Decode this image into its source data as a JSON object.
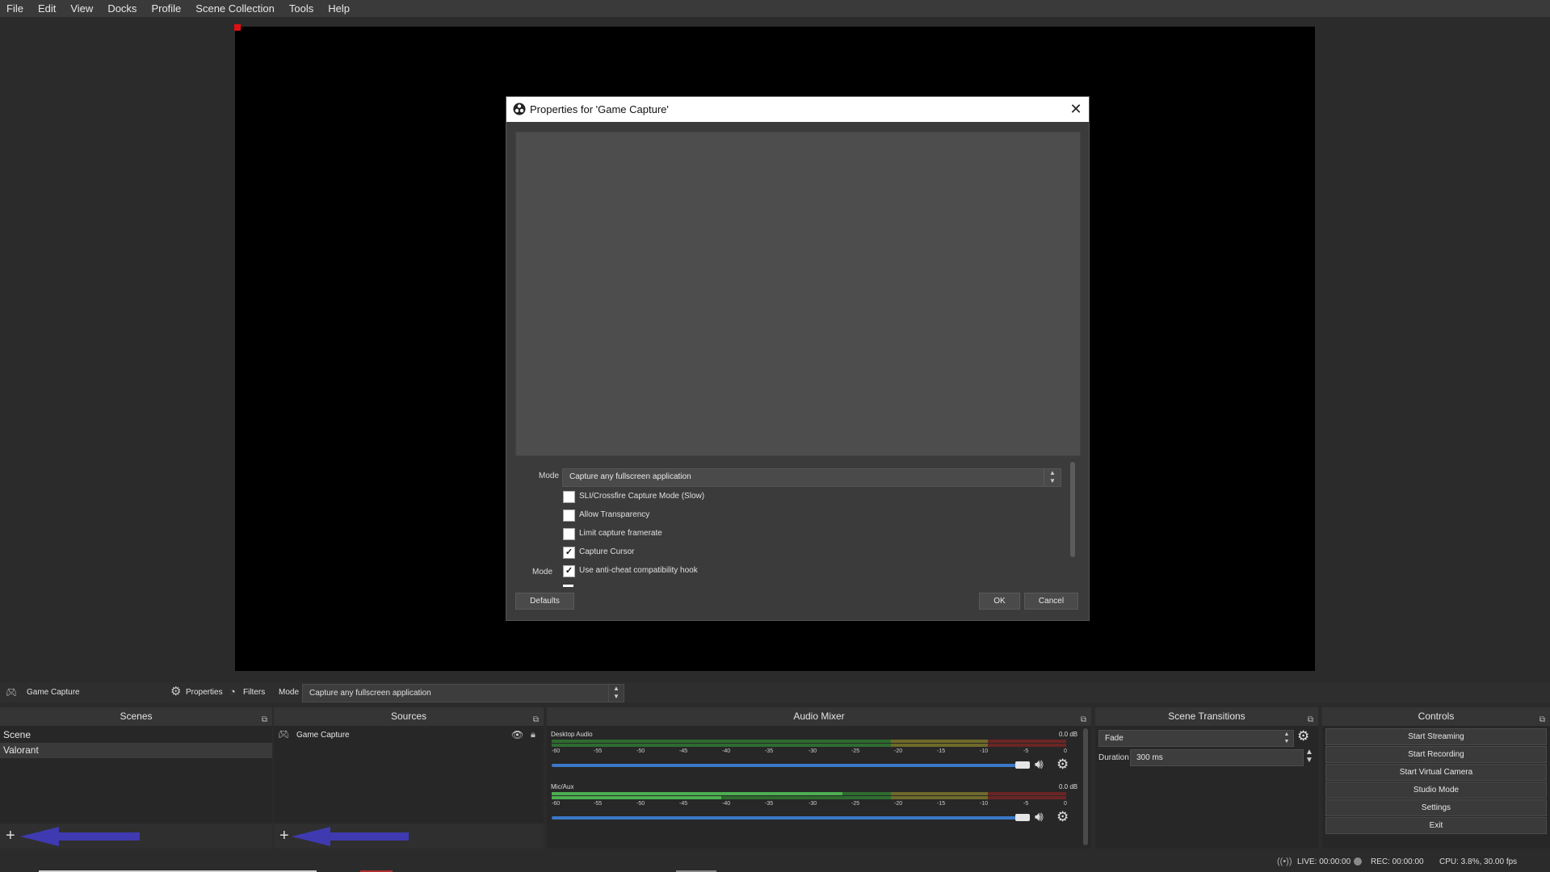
{
  "menu": [
    "File",
    "Edit",
    "View",
    "Docks",
    "Profile",
    "Scene Collection",
    "Tools",
    "Help"
  ],
  "dialog": {
    "title": "Properties for 'Game Capture'",
    "mode_label": "Mode",
    "mode_value": "Capture any fullscreen application",
    "checkboxes": [
      {
        "label": "SLI/Crossfire Capture Mode (Slow)",
        "checked": false
      },
      {
        "label": "Allow Transparency",
        "checked": false
      },
      {
        "label": "Limit capture framerate",
        "checked": false
      },
      {
        "label": "Capture Cursor",
        "checked": true
      },
      {
        "label": "Use anti-cheat compatibility hook",
        "checked": true
      }
    ],
    "defaults_label": "Defaults",
    "ok_label": "OK",
    "cancel_label": "Cancel"
  },
  "context_bar": {
    "source_name": "Game Capture",
    "properties_label": "Properties",
    "filters_label": "Filters",
    "mode_label": "Mode",
    "mode_value": "Capture any fullscreen application"
  },
  "scenes": {
    "title": "Scenes",
    "items": [
      "Scene",
      "Valorant"
    ]
  },
  "sources": {
    "title": "Sources",
    "items": [
      "Game Capture"
    ]
  },
  "mixer": {
    "title": "Audio Mixer",
    "ticks": [
      "-60",
      "-55",
      "-50",
      "-45",
      "-40",
      "-35",
      "-30",
      "-25",
      "-20",
      "-15",
      "-10",
      "-5",
      "0"
    ],
    "channels": [
      {
        "name": "Desktop Audio",
        "db": "0.0 dB"
      },
      {
        "name": "Mic/Aux",
        "db": "0.0 dB"
      }
    ]
  },
  "transitions": {
    "title": "Scene Transitions",
    "value": "Fade",
    "duration_label": "Duration",
    "duration_value": "300 ms"
  },
  "controls": {
    "title": "Controls",
    "buttons": [
      "Start Streaming",
      "Start Recording",
      "Start Virtual Camera",
      "Studio Mode",
      "Settings",
      "Exit"
    ]
  },
  "status": {
    "live": "LIVE: 00:00:00",
    "rec": "REC: 00:00:00",
    "cpu": "CPU: 3.8%, 30.00 fps"
  },
  "colors": {
    "accent_blue": "#3a78c8",
    "arrow_purple": "#3f3ab0",
    "meter_green": "#4caf50",
    "meter_yellow": "#c8b030",
    "meter_red": "#c83030"
  }
}
